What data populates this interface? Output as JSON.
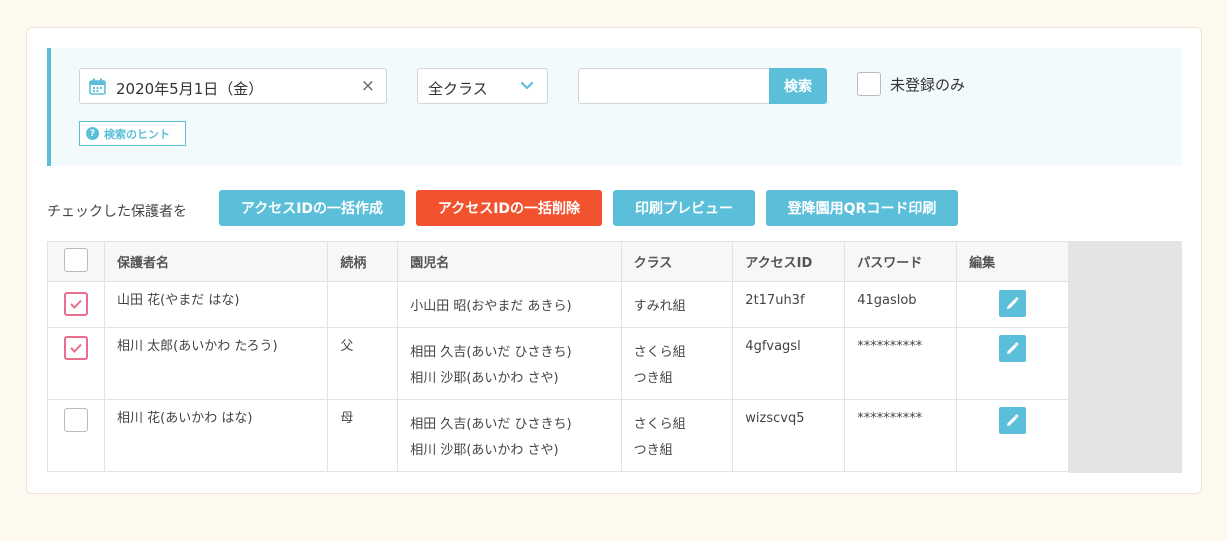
{
  "filter": {
    "date_value": "2020年5月1日（金）",
    "clear_glyph": "×",
    "class_select": "全クラス",
    "search_placeholder": "",
    "search_button": "検索",
    "unregistered_only": "未登録のみ",
    "hint": "検索のヒント"
  },
  "actions": {
    "label": "チェックした保護者を",
    "bulk_create": "アクセスIDの一括作成",
    "bulk_delete": "アクセスIDの一括削除",
    "print_preview": "印刷プレビュー",
    "qr_print": "登降園用QRコード印刷"
  },
  "table": {
    "headers": [
      "保護者名",
      "続柄",
      "園児名",
      "クラス",
      "アクセスID",
      "パスワード",
      "編集"
    ],
    "rows": [
      {
        "checked": true,
        "guardian": "山田 花(やまだ はな)",
        "relation": "",
        "children": [
          "小山田 昭(おやまだ あきら)"
        ],
        "classes": [
          "すみれ組"
        ],
        "access_id": "2t17uh3f",
        "password": "41gaslob"
      },
      {
        "checked": true,
        "guardian": "相川 太郎(あいかわ たろう)",
        "relation": "父",
        "children": [
          "相田 久吉(あいだ ひさきち)",
          "相川 沙耶(あいかわ さや)"
        ],
        "classes": [
          "さくら組",
          "つき組"
        ],
        "access_id": "4gfvagsl",
        "password": "**********"
      },
      {
        "checked": false,
        "guardian": "相川 花(あいかわ はな)",
        "relation": "母",
        "children": [
          "相田 久吉(あいだ ひさきち)",
          "相川 沙耶(あいかわ さや)"
        ],
        "classes": [
          "さくら組",
          "つき組"
        ],
        "access_id": "wizscvq5",
        "password": "**********"
      }
    ]
  },
  "colors": {
    "accent": "#5bbfda",
    "danger": "#f2522e",
    "check": "#e8708e"
  }
}
